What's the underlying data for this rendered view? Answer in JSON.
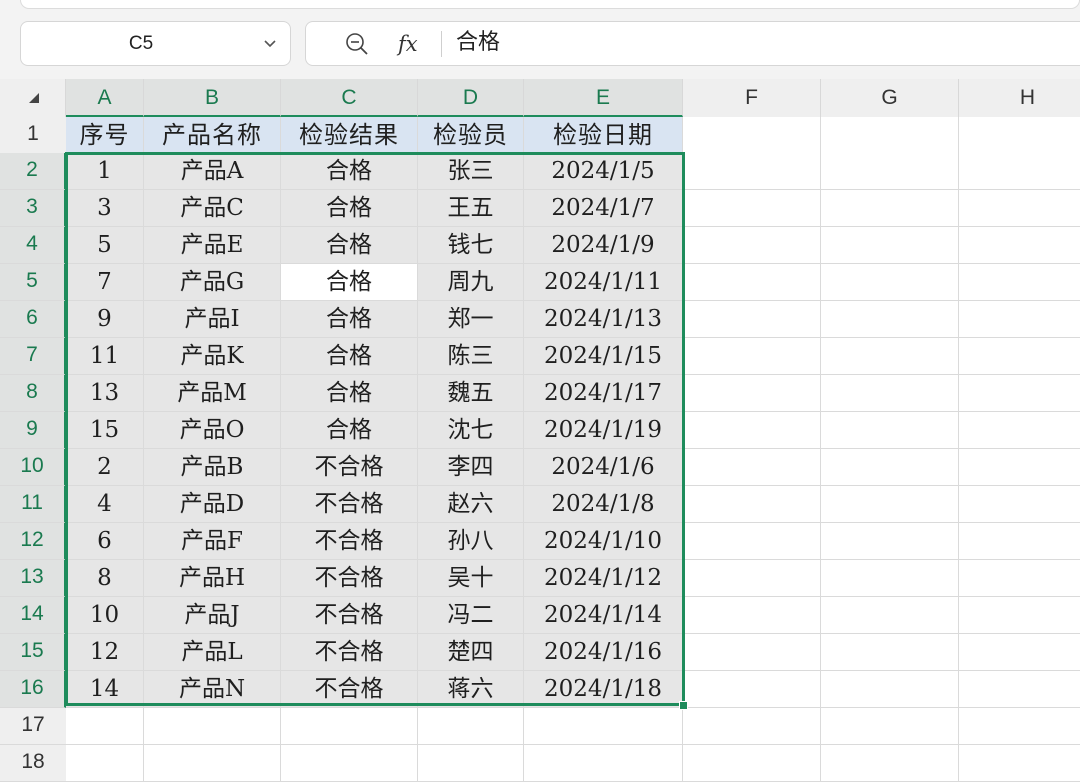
{
  "name_box": {
    "cell_ref": "C5"
  },
  "formula_bar": {
    "value": "合格",
    "fx_label": "fx"
  },
  "columns": [
    "A",
    "B",
    "C",
    "D",
    "E",
    "F",
    "G",
    "H"
  ],
  "selected_columns": [
    "A",
    "B",
    "C",
    "D",
    "E"
  ],
  "row_numbers": [
    "1",
    "2",
    "3",
    "4",
    "5",
    "6",
    "7",
    "8",
    "9",
    "10",
    "11",
    "12",
    "13",
    "14",
    "15",
    "16",
    "17",
    "18"
  ],
  "selected_rows": [
    "2",
    "3",
    "4",
    "5",
    "6",
    "7",
    "8",
    "9",
    "10",
    "11",
    "12",
    "13",
    "14",
    "15",
    "16"
  ],
  "header_row": [
    "序号",
    "产品名称",
    "检验结果",
    "检验员",
    "检验日期"
  ],
  "rows": [
    [
      "1",
      "产品A",
      "合格",
      "张三",
      "2024/1/5"
    ],
    [
      "3",
      "产品C",
      "合格",
      "王五",
      "2024/1/7"
    ],
    [
      "5",
      "产品E",
      "合格",
      "钱七",
      "2024/1/9"
    ],
    [
      "7",
      "产品G",
      "合格",
      "周九",
      "2024/1/11"
    ],
    [
      "9",
      "产品I",
      "合格",
      "郑一",
      "2024/1/13"
    ],
    [
      "11",
      "产品K",
      "合格",
      "陈三",
      "2024/1/15"
    ],
    [
      "13",
      "产品M",
      "合格",
      "魏五",
      "2024/1/17"
    ],
    [
      "15",
      "产品O",
      "合格",
      "沈七",
      "2024/1/19"
    ],
    [
      "2",
      "产品B",
      "不合格",
      "李四",
      "2024/1/6"
    ],
    [
      "4",
      "产品D",
      "不合格",
      "赵六",
      "2024/1/8"
    ],
    [
      "6",
      "产品F",
      "不合格",
      "孙八",
      "2024/1/10"
    ],
    [
      "8",
      "产品H",
      "不合格",
      "吴十",
      "2024/1/12"
    ],
    [
      "10",
      "产品J",
      "不合格",
      "冯二",
      "2024/1/14"
    ],
    [
      "12",
      "产品L",
      "不合格",
      "楚四",
      "2024/1/16"
    ],
    [
      "14",
      "产品N",
      "不合格",
      "蒋六",
      "2024/1/18"
    ]
  ],
  "icons": {
    "name_box_dropdown": "chevron-down-icon",
    "formula_zoom": "zoom-out-icon",
    "select_all": "select-all-triangle-icon"
  },
  "colors": {
    "selection_border": "#1e8c5c",
    "header_fill": "#d9e4f2",
    "selected_fill": "#e6e6e6",
    "active_cell_fill": "#ffffff"
  }
}
